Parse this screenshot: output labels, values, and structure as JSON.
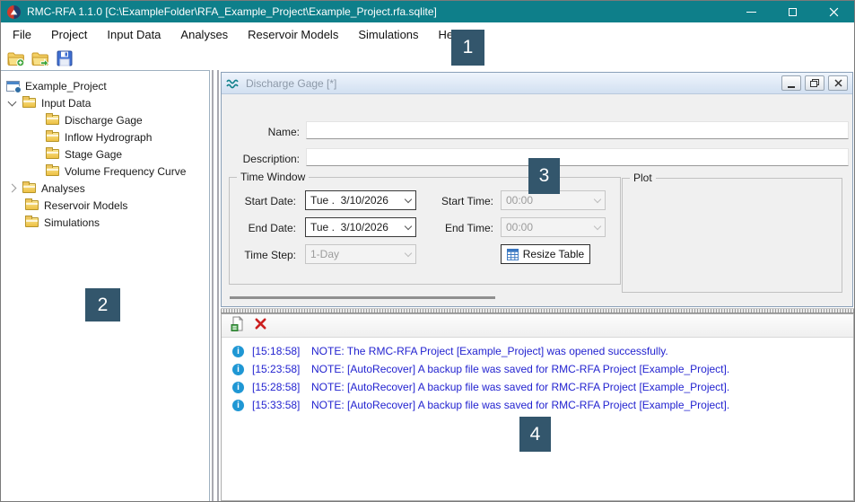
{
  "titlebar": {
    "title": "RMC-RFA 1.1.0 [C:\\ExampleFolder\\RFA_Example_Project\\Example_Project.rfa.sqlite]"
  },
  "menu": {
    "items": [
      "File",
      "Project",
      "Input Data",
      "Analyses",
      "Reservoir Models",
      "Simulations",
      "Help"
    ]
  },
  "toolbar": {
    "icons": [
      "new-project-folder-icon",
      "open-project-folder-icon",
      "save-icon"
    ]
  },
  "tree": {
    "root": "Example_Project",
    "items": [
      {
        "label": "Input Data",
        "state": "expanded"
      },
      {
        "label": "Discharge Gage"
      },
      {
        "label": "Inflow Hydrograph"
      },
      {
        "label": "Stage Gage"
      },
      {
        "label": "Volume Frequency Curve"
      },
      {
        "label": "Analyses",
        "state": "collapsed"
      },
      {
        "label": "Reservoir Models"
      },
      {
        "label": "Simulations"
      }
    ]
  },
  "doc": {
    "title": "Discharge Gage [*]",
    "name_label": "Name:",
    "name_value": "",
    "description_label": "Description:",
    "description_value": "",
    "time_window": {
      "title": "Time Window",
      "start_date_label": "Start Date:",
      "start_date_value": "Tue .  3/10/2026",
      "start_time_label": "Start Time:",
      "start_time_value": "00:00",
      "end_date_label": "End Date:",
      "end_date_value": "Tue .  3/10/2026",
      "end_time_label": "End Time:",
      "end_time_value": "00:00",
      "time_step_label": "Time Step:",
      "time_step_value": "1-Day",
      "resize_table_label": "Resize Table"
    },
    "plot_title": "Plot"
  },
  "messages": {
    "items": [
      {
        "time": "[15:18:58]",
        "text": "NOTE: The RMC-RFA Project [Example_Project] was opened successfully."
      },
      {
        "time": "[15:23:58]",
        "text": "NOTE: [AutoRecover] A backup file was saved for RMC-RFA Project [Example_Project]."
      },
      {
        "time": "[15:28:58]",
        "text": "NOTE: [AutoRecover] A backup file was saved for RMC-RFA Project [Example_Project]."
      },
      {
        "time": "[15:33:58]",
        "text": "NOTE: [AutoRecover] A backup file was saved for RMC-RFA Project [Example_Project]."
      }
    ]
  },
  "annotations": {
    "items": [
      "1",
      "2",
      "3",
      "4"
    ]
  },
  "colors": {
    "titlebar_teal": "#0e7f8a",
    "annotation_box": "#33566c",
    "log_text": "#2323d0",
    "info_icon_blue": "#1f97d4",
    "folder_gold": "#edc044"
  }
}
